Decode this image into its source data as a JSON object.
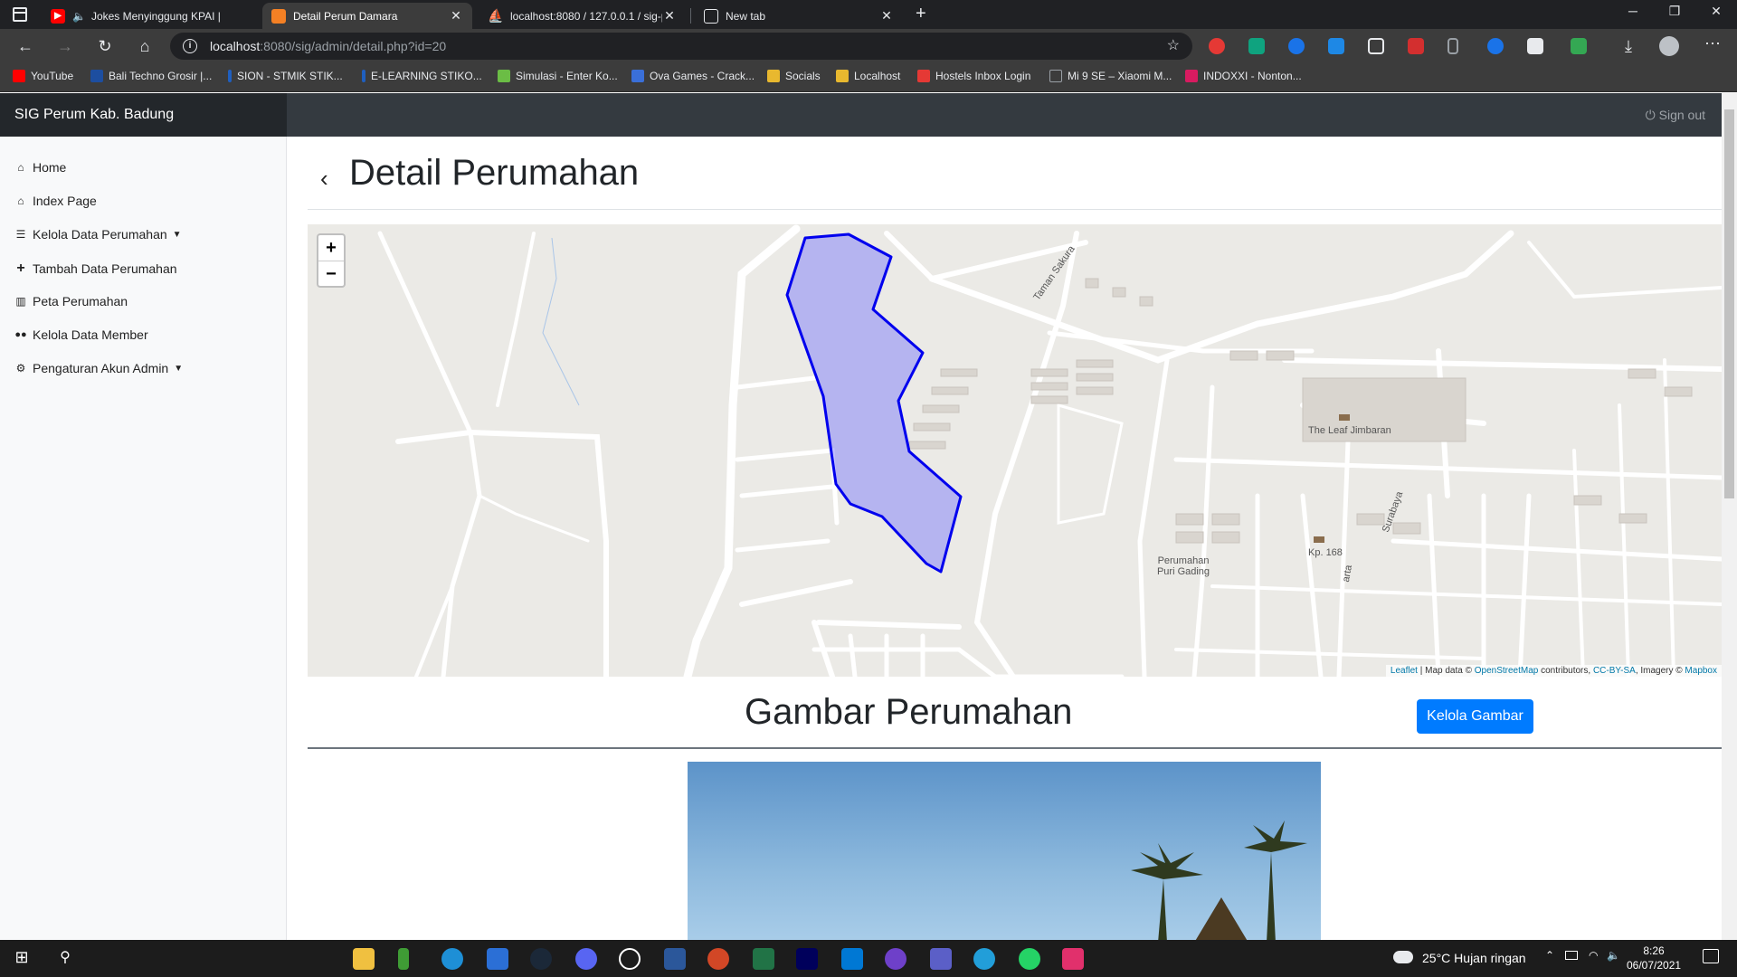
{
  "browser": {
    "tabs": [
      {
        "title": "Jokes Menyinggung KPAI |",
        "favicon": "youtube-icon",
        "color": "#ff0000",
        "muted_icon": "speaker-icon"
      },
      {
        "title": "Detail Perum Damara",
        "favicon": "page-icon",
        "color": "#f48024"
      },
      {
        "title": "localhost:8080 / 127.0.0.1 / sig-p",
        "favicon": "phpmyadmin-icon",
        "color": "#f0a30a"
      },
      {
        "title": "New tab",
        "favicon": "newtab-icon",
        "color": "#5f6368"
      }
    ],
    "url_host": "localhost",
    "url_rest": ":8080/sig/admin/detail.php?id=20",
    "bookmarks": [
      {
        "label": "YouTube",
        "color": "#ff0000"
      },
      {
        "label": "Bali Techno Grosir |...",
        "color": "#1d4ea0"
      },
      {
        "label": "SION - STMIK STIK...",
        "color": "#1f5fbf"
      },
      {
        "label": "E-LEARNING STIKO...",
        "color": "#1f5fbf"
      },
      {
        "label": "Simulasi - Enter Ko...",
        "color": "#6bbd45"
      },
      {
        "label": "Ova Games - Crack...",
        "color": "#3a6fd8"
      },
      {
        "label": "Socials",
        "color": "#e8b82f"
      },
      {
        "label": "Localhost",
        "color": "#e8b82f"
      },
      {
        "label": "Hostels Inbox Login",
        "color": "#e53935"
      },
      {
        "label": "Mi 9 SE – Xiaomi M...",
        "color": "#9aa0a6"
      },
      {
        "label": "INDOXXI - Nonton...",
        "color": "#d81b60"
      }
    ]
  },
  "app": {
    "brand": "SIG Perum Kab. Badung",
    "signout": "Sign out",
    "sidebar": [
      {
        "label": "Home",
        "icon": "home-icon",
        "glyph": "⌂"
      },
      {
        "label": "Index Page",
        "icon": "home-icon",
        "glyph": "⌂"
      },
      {
        "label": "Kelola Data Perumahan",
        "icon": "list-icon",
        "glyph": "☰",
        "dropdown": true
      },
      {
        "label": "Tambah Data Perumahan",
        "icon": "plus-icon",
        "glyph": "+"
      },
      {
        "label": "Peta Perumahan",
        "icon": "map-icon",
        "glyph": "▥"
      },
      {
        "label": "Kelola Data Member",
        "icon": "users-icon",
        "glyph": "👥"
      },
      {
        "label": "Pengaturan Akun Admin",
        "icon": "gear-icon",
        "glyph": "⚙",
        "dropdown": true
      }
    ],
    "page_title": "Detail Perumahan",
    "map": {
      "zoom_in": "+",
      "zoom_out": "−",
      "labels": [
        "Taman Sakura",
        "The Leaf Jimbaran",
        "Kp. 168",
        "Perumahan Puri Gading",
        "Surabaya",
        "arta"
      ],
      "attribution": {
        "leaflet": "Leaflet",
        "sep": " | Map data © ",
        "osm": "OpenStreetMap",
        "contrib": " contributors, ",
        "license": "CC-BY-SA",
        "imagery": ", Imagery © ",
        "mapbox": "Mapbox"
      },
      "polygon_color": "#0000ee"
    },
    "gallery_title": "Gambar Perumahan",
    "manage_button": "Kelola Gambar",
    "accent": "#007bff"
  },
  "taskbar": {
    "weather": "25°C  Hujan ringan",
    "time": "8:26",
    "date": "06/07/2021"
  }
}
